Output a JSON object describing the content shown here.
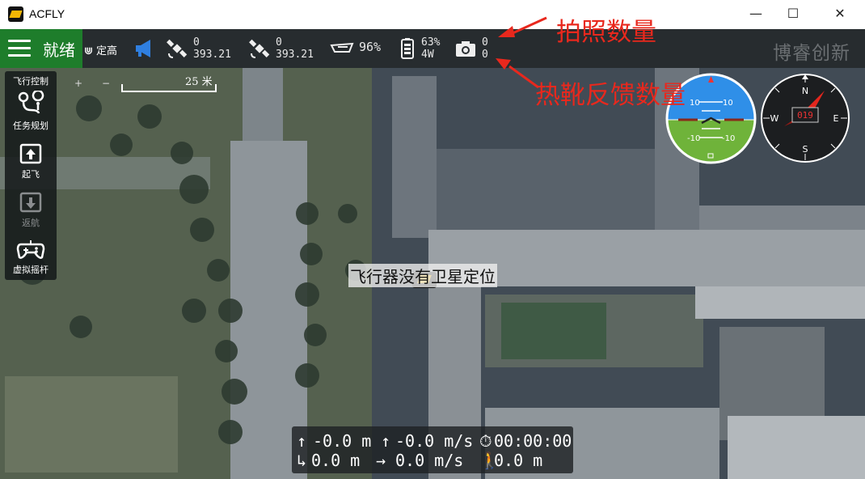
{
  "window": {
    "title": "ACFLY",
    "minimize": "—",
    "maximize": "☐",
    "close": "✕"
  },
  "toolbar": {
    "status": "就绪",
    "mode_label": "定高",
    "gps1": {
      "count": "0",
      "value": "393.21"
    },
    "gps2": {
      "count": "0",
      "value": "393.21"
    },
    "signal": "96%",
    "battery": {
      "percent": "63%",
      "power": "4W"
    },
    "camera": {
      "photos": "0",
      "hotshoe": "0"
    },
    "brand": "博睿创新"
  },
  "sidebar": {
    "header": "飞行控制",
    "items": [
      {
        "label": "任务规划",
        "icon": "mission-plan-icon",
        "enabled": true
      },
      {
        "label": "起飞",
        "icon": "takeoff-icon",
        "enabled": true
      },
      {
        "label": "返航",
        "icon": "return-home-icon",
        "enabled": false
      },
      {
        "label": "虚拟摇杆",
        "icon": "gamepad-icon",
        "enabled": true
      }
    ]
  },
  "map": {
    "scale": "25 米",
    "zoom_in": "+",
    "zoom_out": "−",
    "gps_warning": "飞行器没有卫星定位"
  },
  "annotations": {
    "photo_count": "拍照数量",
    "hotshoe_count": "热靴反馈数量"
  },
  "instruments": {
    "attitude": {
      "pitch_up": "10",
      "pitch_down": "-10"
    },
    "compass": {
      "heading": "019",
      "n": "N",
      "e": "E",
      "s": "S",
      "w": "W"
    }
  },
  "telemetry": {
    "row1": {
      "altitude": "-0.0 m",
      "vspeed": "-0.0 m/s",
      "timer": "00:00:00"
    },
    "row2": {
      "distance": "0.0 m",
      "hspeed": "0.0 m/s",
      "walk": "0.0 m"
    }
  },
  "colors": {
    "accent_green": "#1e7d2b",
    "toolbar": "#272c2f",
    "annotation": "#e8281d",
    "sky": "#2f8fe8",
    "ground": "#6fb33a"
  }
}
